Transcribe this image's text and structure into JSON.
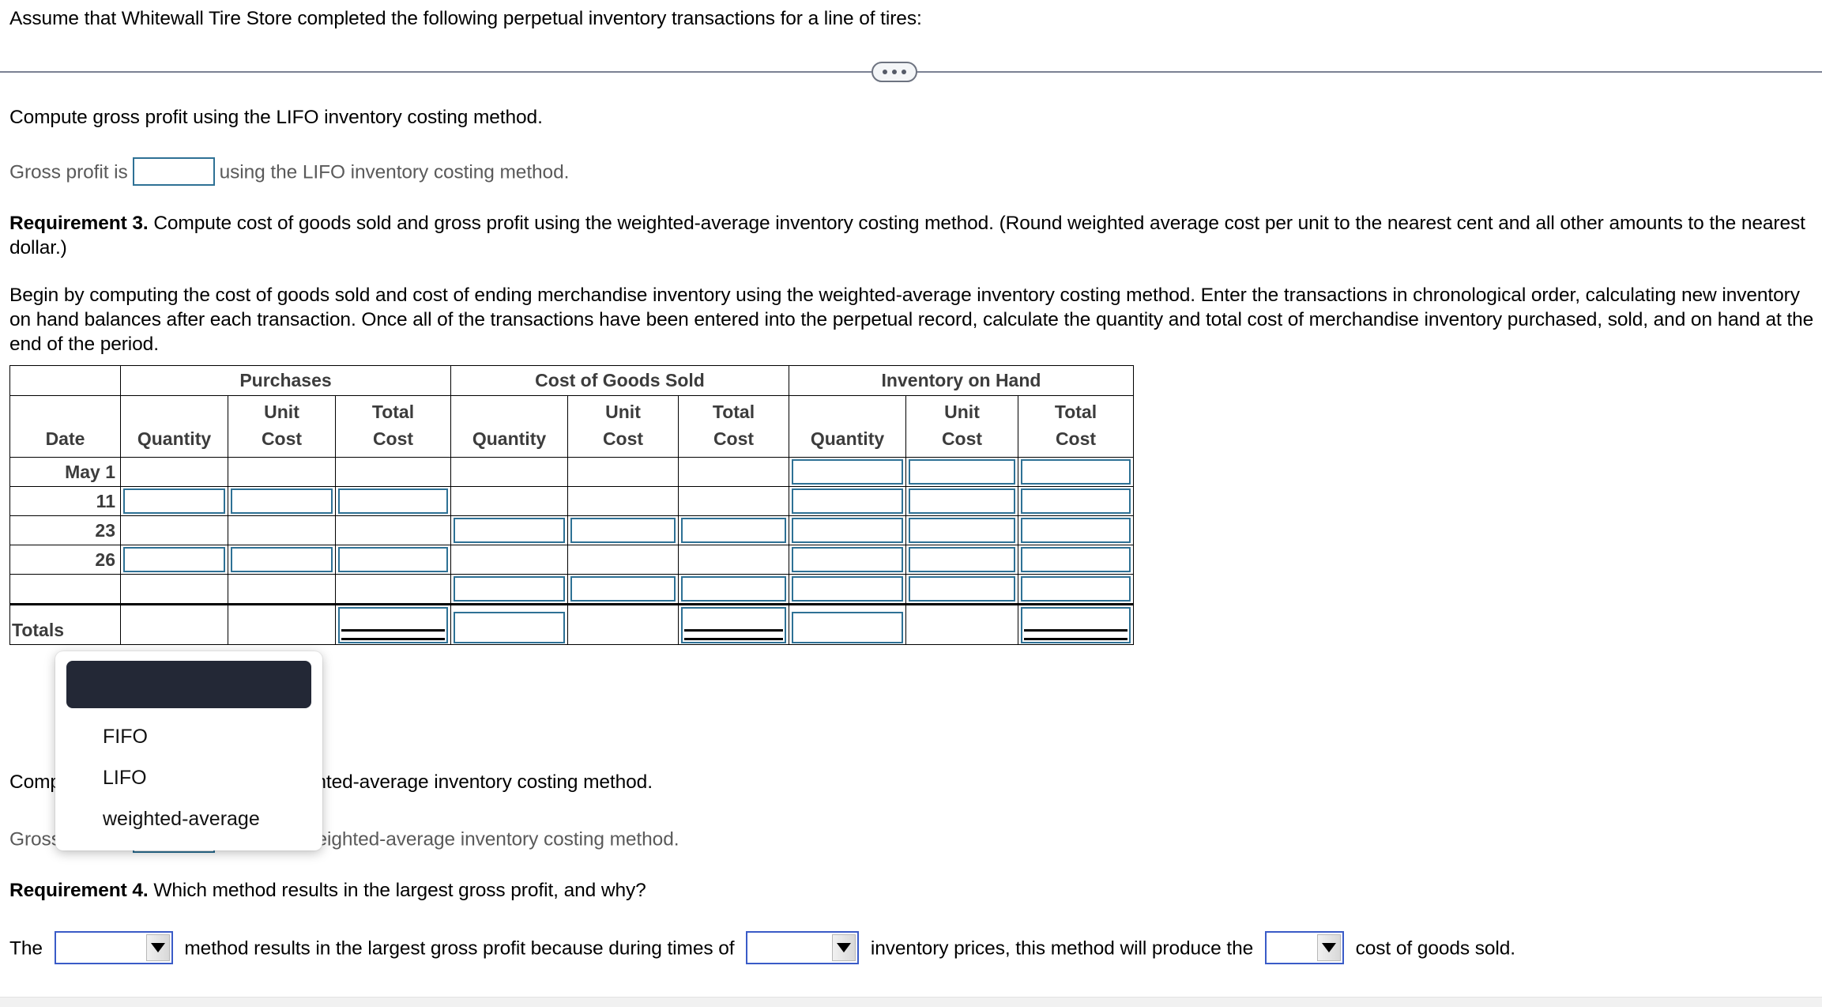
{
  "intro": {
    "text": "Assume that Whitewall Tire Store completed the following perpetual inventory transactions for a line of tires:"
  },
  "divider": {
    "dots_label": "•••"
  },
  "lifo_section": {
    "prompt": "Compute gross profit using the LIFO inventory costing method.",
    "answer_prefix": "Gross profit is",
    "answer_suffix": "using the LIFO inventory costing method."
  },
  "requirement3": {
    "label": "Requirement 3.",
    "text": "Compute cost of goods sold and gross profit using the weighted-average inventory costing method. (Round weighted average cost per unit to the nearest cent and all other amounts to the nearest dollar.)",
    "instructions": "Begin by computing the cost of goods sold and cost of ending merchandise inventory using the weighted-average inventory costing method. Enter the transactions in chronological order, calculating new inventory on hand balances after each transaction. Once all of the transactions have been entered into the perpetual record, calculate the quantity and total cost of merchandise inventory purchased, sold, and on hand at the end of the period."
  },
  "table": {
    "group_headers": [
      "",
      "Purchases",
      "Cost of Goods Sold",
      "Inventory on Hand"
    ],
    "sub_headers": {
      "date": "Date",
      "purchases": [
        "Quantity",
        "Unit\nCost",
        "Total\nCost"
      ],
      "cogs": [
        "Quantity",
        "Unit\nCost",
        "Total\nCost"
      ],
      "inventory": [
        "Quantity",
        "Unit\nCost",
        "Total\nCost"
      ]
    },
    "sub_header_labels": {
      "quantity": "Quantity",
      "unit": "Unit",
      "total": "Total",
      "cost": "Cost"
    },
    "rows": [
      {
        "date": "May 1",
        "purchases": [
          false,
          false,
          false
        ],
        "cogs": [
          false,
          false,
          false
        ],
        "inventory": [
          true,
          true,
          true
        ]
      },
      {
        "date": "11",
        "purchases": [
          true,
          true,
          true
        ],
        "cogs": [
          false,
          false,
          false
        ],
        "inventory": [
          true,
          true,
          true
        ]
      },
      {
        "date": "23",
        "purchases": [
          false,
          false,
          false
        ],
        "cogs": [
          true,
          true,
          true
        ],
        "inventory": [
          true,
          true,
          true
        ]
      },
      {
        "date": "26",
        "purchases": [
          true,
          true,
          true
        ],
        "cogs": [
          false,
          false,
          false
        ],
        "inventory": [
          true,
          true,
          true
        ]
      },
      {
        "date": "",
        "purchases": [
          false,
          false,
          false
        ],
        "cogs": [
          true,
          true,
          true
        ],
        "inventory": [
          true,
          true,
          true
        ]
      }
    ],
    "total_row": {
      "label": "Totals",
      "purchases": [
        false,
        false,
        true
      ],
      "cogs": [
        true,
        false,
        true
      ],
      "inventory": [
        true,
        false,
        true
      ]
    }
  },
  "wavg_section": {
    "prompt": "Compute gross profit using the weighted-average inventory costing method.",
    "answer_prefix": "Gross profit is",
    "answer_suffix": "using the weighted-average inventory costing method."
  },
  "requirement4": {
    "label": "Requirement 4.",
    "text": "Which method results in the largest gross profit, and why?"
  },
  "dropdown": {
    "open": true,
    "options": [
      "",
      "FIFO",
      "LIFO",
      "weighted-average"
    ],
    "selected_index": 0,
    "highlight_color": "#232836"
  },
  "conclusion": {
    "seg1": "The",
    "seg2": "method results in the largest gross profit because during times of",
    "seg3": "inventory prices, this method will produce the",
    "seg4": "cost of goods sold.",
    "select1_value": "",
    "select2_value": "",
    "select3_value": ""
  },
  "colors": {
    "input_border": "#2e7195",
    "select_border": "#3a5bc7",
    "table_border": "#000000",
    "muted_text": "#5a5a5a",
    "header_text": "#3c3c3c"
  }
}
